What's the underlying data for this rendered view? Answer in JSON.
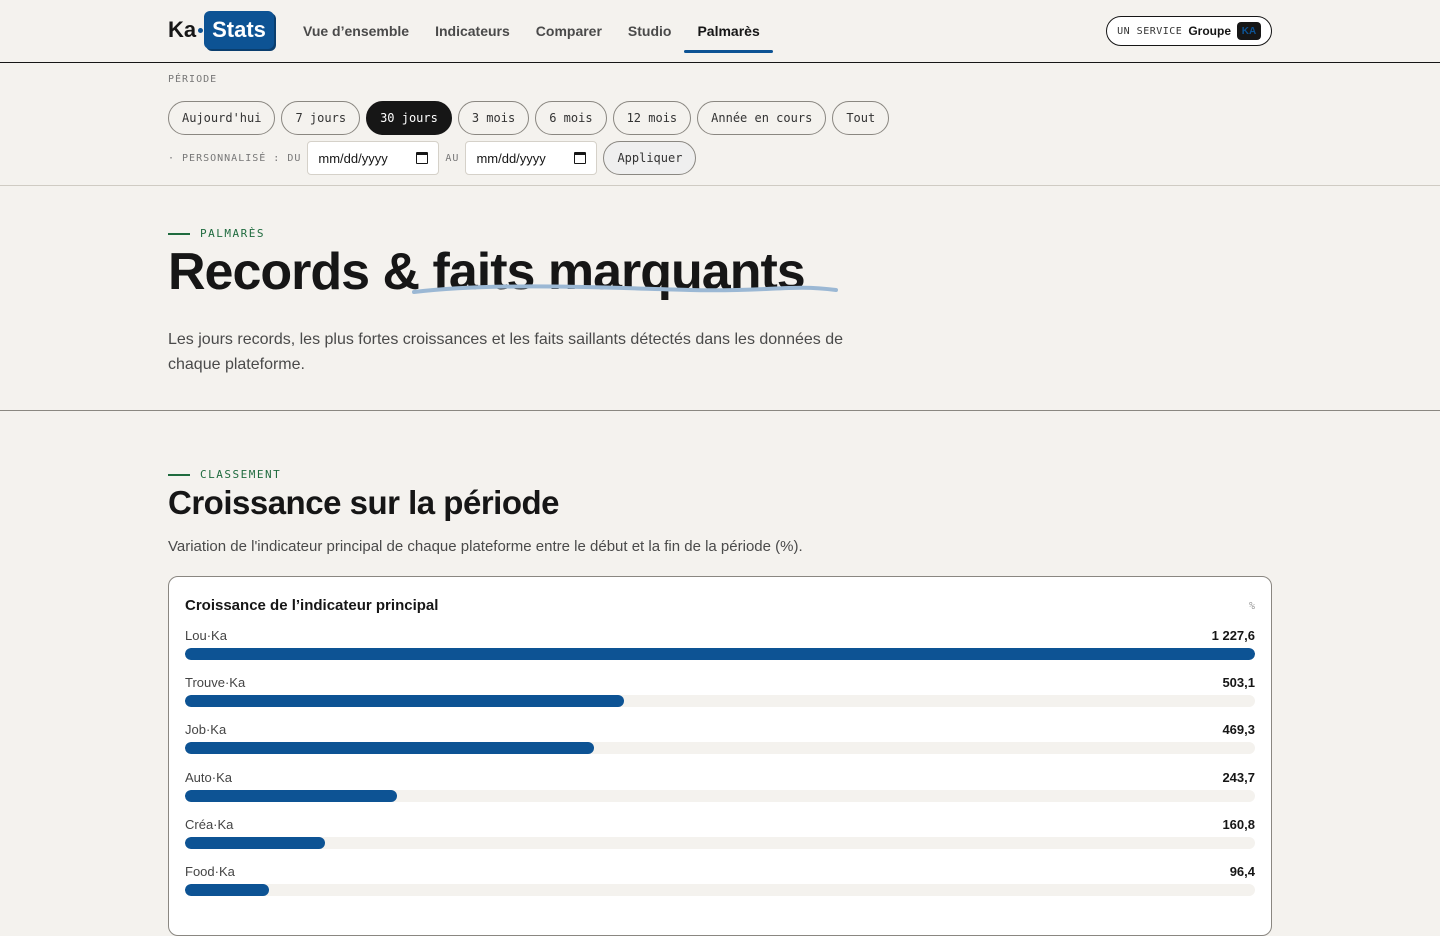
{
  "header": {
    "logo_ka": "Ka",
    "logo_stats": "Stats",
    "nav": [
      {
        "label": "Vue d’ensemble",
        "active": false
      },
      {
        "label": "Indicateurs",
        "active": false
      },
      {
        "label": "Comparer",
        "active": false
      },
      {
        "label": "Studio",
        "active": false
      },
      {
        "label": "Palmarès",
        "active": true
      }
    ],
    "service_label": "UN SERVICE",
    "service_group": "Groupe",
    "service_logo": "KA"
  },
  "period": {
    "label": "PÉRIODE",
    "chips": [
      {
        "label": "Aujourd'hui",
        "active": false
      },
      {
        "label": "7 jours",
        "active": false
      },
      {
        "label": "30 jours",
        "active": true
      },
      {
        "label": "3 mois",
        "active": false
      },
      {
        "label": "6 mois",
        "active": false
      },
      {
        "label": "12 mois",
        "active": false
      },
      {
        "label": "Année en cours",
        "active": false
      },
      {
        "label": "Tout",
        "active": false
      }
    ],
    "custom_label": "· PERSONNALISÉ : DU",
    "from_placeholder": "mm/dd/yyyy",
    "to_label": "AU",
    "to_placeholder": "mm/dd/yyyy",
    "apply_label": "Appliquer"
  },
  "hero": {
    "eyebrow": "PALMARÈS",
    "title": "Records & faits marquants",
    "description": "Les jours records, les plus fortes croissances et les faits saillants détectés dans les données de chaque plateforme."
  },
  "ranking": {
    "eyebrow": "CLASSEMENT",
    "title": "Croissance sur la période",
    "description": "Variation de l'indicateur principal de chaque plateforme entre le début et la fin de la période (%).",
    "card_title": "Croissance de l’indicateur principal",
    "unit": "%"
  },
  "chart_data": {
    "type": "bar",
    "title": "Croissance de l’indicateur principal",
    "ylabel": "%",
    "categories": [
      "Lou·Ka",
      "Trouve·Ka",
      "Job·Ka",
      "Auto·Ka",
      "Créa·Ka",
      "Food·Ka"
    ],
    "values": [
      1227.6,
      503.1,
      469.3,
      243.7,
      160.8,
      96.4
    ],
    "value_labels": [
      "1 227,6",
      "503,1",
      "469,3",
      "243,7",
      "160,8",
      "96,4"
    ],
    "colors": {
      "bar": "#0d5394",
      "track": "#f4f2ee"
    }
  }
}
